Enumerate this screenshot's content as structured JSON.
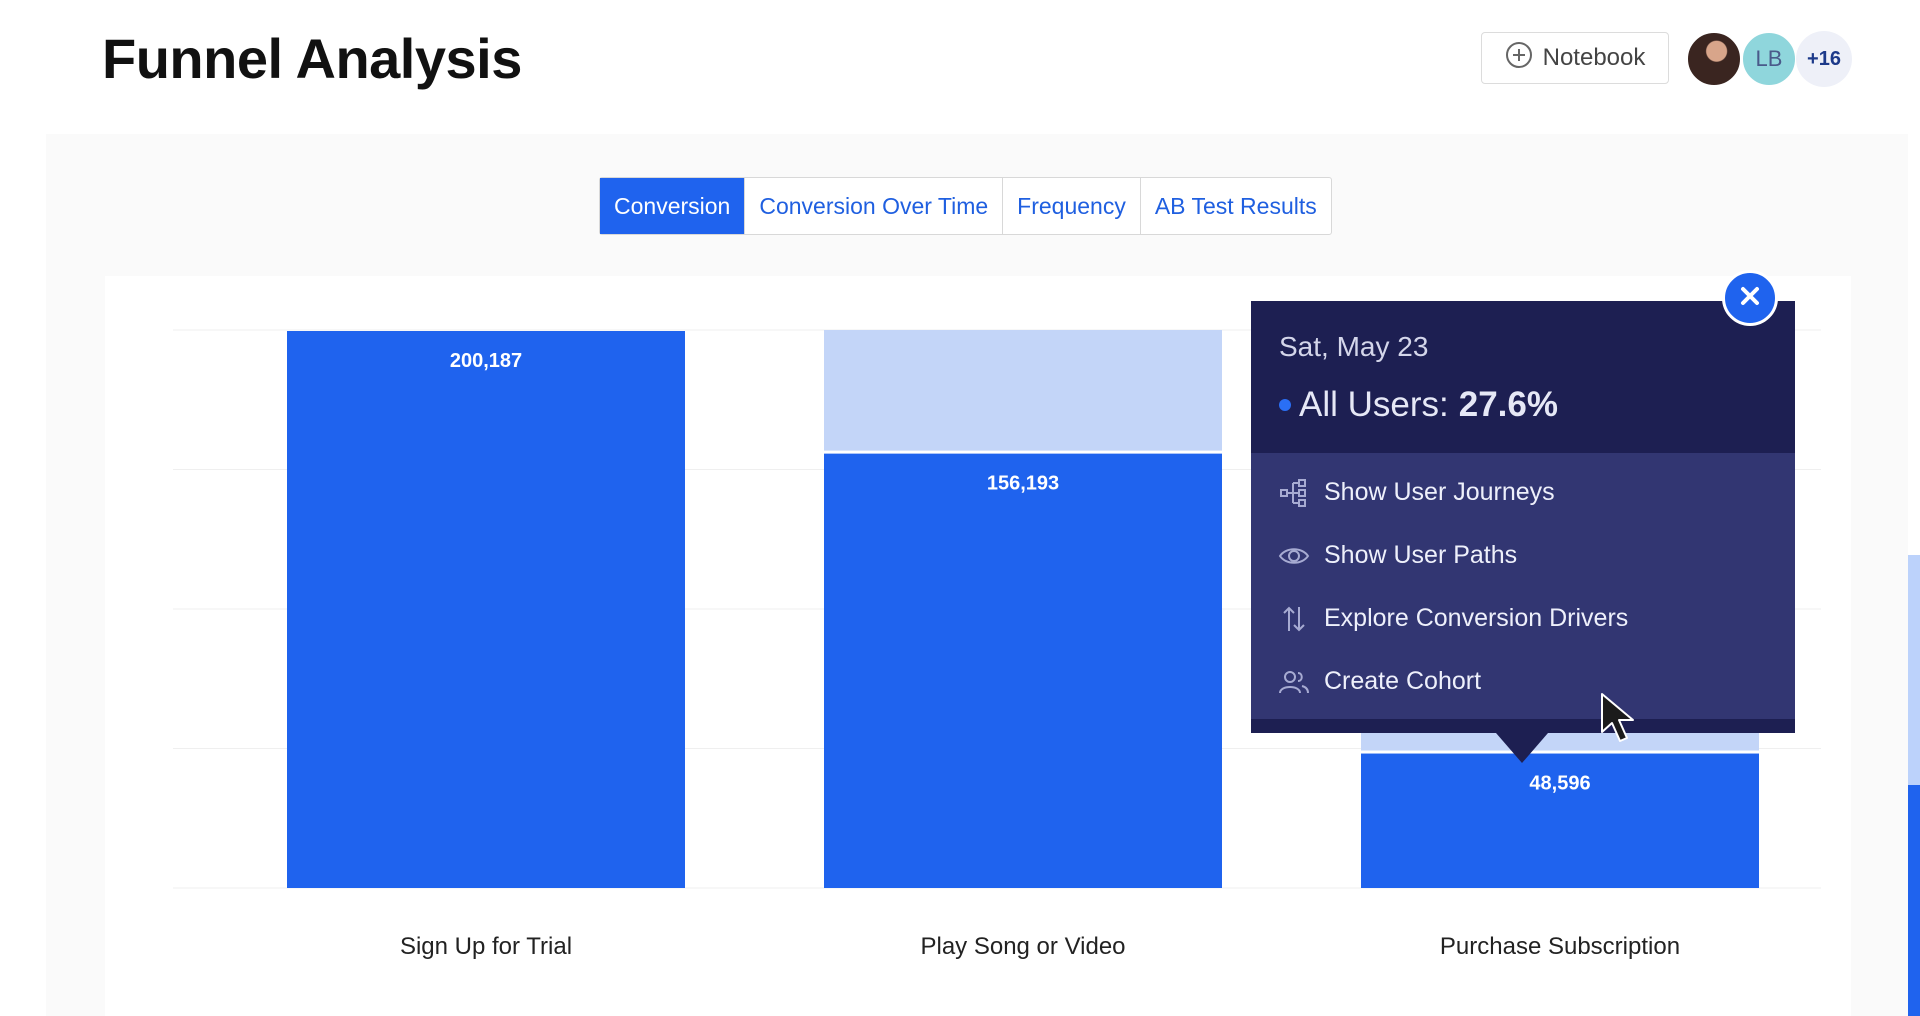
{
  "header": {
    "title": "Funnel Analysis",
    "notebook_label": "Notebook",
    "avatars": [
      {
        "kind": "photo",
        "initials": ""
      },
      {
        "kind": "initials",
        "initials": "LB"
      },
      {
        "kind": "overflow",
        "initials": "+16"
      }
    ]
  },
  "tabs": [
    {
      "label": "Conversion",
      "active": true
    },
    {
      "label": "Conversion Over Time",
      "active": false
    },
    {
      "label": "Frequency",
      "active": false
    },
    {
      "label": "AB Test Results",
      "active": false
    }
  ],
  "tooltip": {
    "date": "Sat, May 23",
    "series_label": "All Users:",
    "series_value": "27.6%",
    "series_color": "#2a6ff5",
    "actions": [
      {
        "label": "Show User Journeys",
        "icon": "user-journeys-icon"
      },
      {
        "label": "Show User Paths",
        "icon": "eye-icon"
      },
      {
        "label": "Explore Conversion Drivers",
        "icon": "arrows-up-down-icon"
      },
      {
        "label": "Create Cohort",
        "icon": "users-icon"
      }
    ]
  },
  "colors": {
    "converted": "#1f63ee",
    "dropped": "#c3d5f8",
    "tooltip_dark": "#1d1f52",
    "tooltip_menu": "#323672"
  },
  "chart_data": {
    "type": "bar",
    "stacked": true,
    "categories": [
      "Sign Up for Trial",
      "Play Song or Video",
      "Purchase Subscription"
    ],
    "series": [
      {
        "values": [
          200187,
          156193,
          48596
        ]
      },
      {
        "values": [
          0,
          43994,
          107597
        ]
      }
    ],
    "data_labels": [
      "200,187",
      "156,193",
      "48,596"
    ],
    "ylim": [
      0,
      200187
    ],
    "grid": true
  }
}
